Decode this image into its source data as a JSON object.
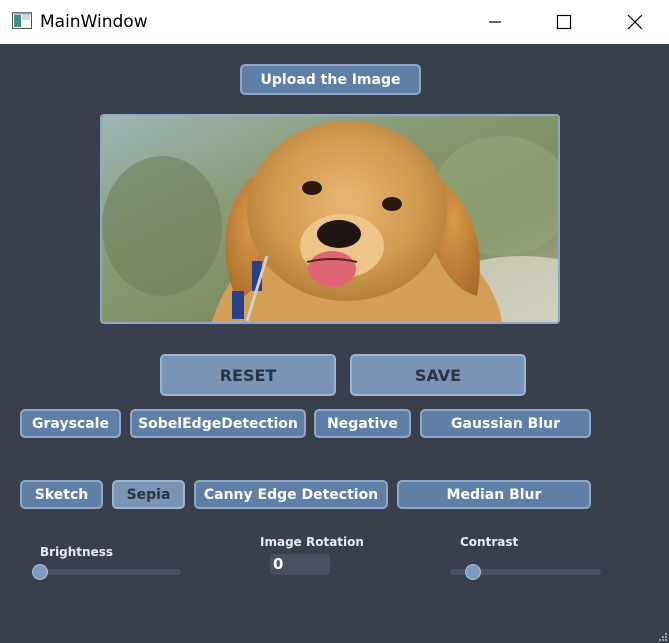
{
  "window": {
    "title": "MainWindow"
  },
  "buttons": {
    "upload": "Upload the Image",
    "reset": "RESET",
    "save": "SAVE",
    "grayscale": "Grayscale",
    "sobel": "SobelEdgeDetection",
    "negative": "Negative",
    "gaussian": "Gaussian Blur",
    "sketch": "Sketch",
    "sepia": "Sepia",
    "canny": "Canny Edge Detection",
    "median": "Median Blur"
  },
  "controls": {
    "brightness_label": "Brightness",
    "brightness_value": 0.0,
    "rotation_label": "Image Rotation",
    "rotation_value": "0",
    "contrast_label": "Contrast",
    "contrast_value": 0.15
  },
  "icons": {
    "app": "app-window-icon",
    "minimize": "minimize-icon",
    "maximize": "maximize-icon",
    "close": "close-icon",
    "resize": "resize-grip-icon"
  }
}
